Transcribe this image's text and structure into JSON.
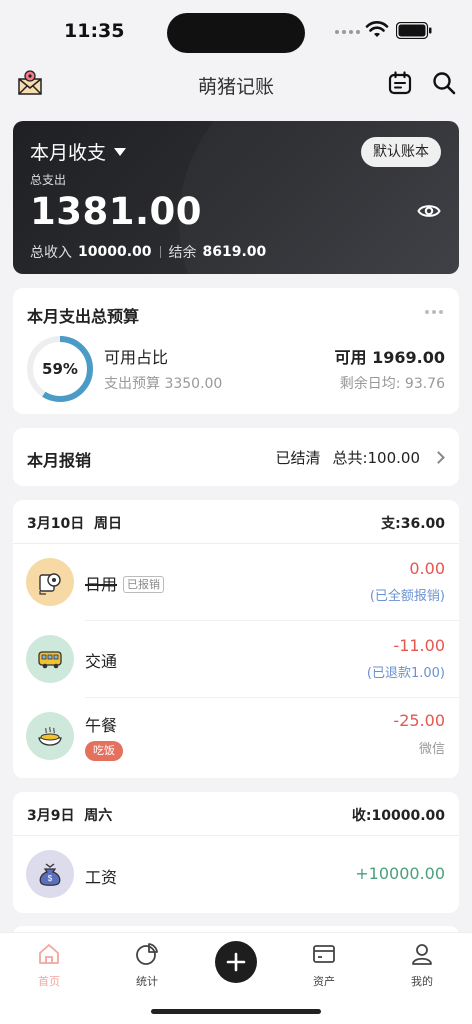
{
  "status": {
    "time": "11:35"
  },
  "nav": {
    "title": "萌猪记账"
  },
  "summary": {
    "period_label": "本月收支",
    "book_button": "默认账本",
    "expense_label": "总支出",
    "expense_amount": "1381.00",
    "income_label": "总收入",
    "income_amount": "10000.00",
    "balance_label": "结余",
    "balance_amount": "8619.00"
  },
  "budget": {
    "title": "本月支出总预算",
    "percent": "59%",
    "percent_value": 0.59,
    "available_ratio_label": "可用占比",
    "budget_text": "支出预算 3350.00",
    "available_text": "可用 1969.00",
    "daily_text": "剩余日均: 93.76"
  },
  "reimbursement": {
    "title": "本月报销",
    "status": "已结清",
    "total": "总共:100.00"
  },
  "days": [
    {
      "date": "3月10日",
      "weekday": "周日",
      "summary": "支:36.00",
      "items": [
        {
          "category": "日用",
          "tag": "已报销",
          "amount": "0.00",
          "note": "(已全额报销)",
          "icon": "toilet-paper-icon"
        },
        {
          "category": "交通",
          "amount": "-11.00",
          "note": "(已退款1.00)",
          "icon": "bus-icon"
        },
        {
          "category": "午餐",
          "tag": "吃饭",
          "amount": "-25.00",
          "note": "微信",
          "icon": "meal-icon"
        }
      ]
    },
    {
      "date": "3月9日",
      "weekday": "周六",
      "summary": "收:10000.00",
      "items": [
        {
          "category": "工资",
          "amount": "+10000.00",
          "icon": "money-bag-icon"
        }
      ]
    }
  ],
  "tabs": [
    {
      "label": "首页",
      "icon": "home-icon",
      "active": true
    },
    {
      "label": "统计",
      "icon": "pie-chart-icon"
    },
    {
      "label": "add",
      "icon": "plus-icon"
    },
    {
      "label": "资产",
      "icon": "card-icon"
    },
    {
      "label": "我的",
      "icon": "person-icon"
    }
  ],
  "colors": {
    "expense": "#e5574f",
    "income": "#4aa07e",
    "refund_note": "#6b92d0",
    "ring": "#4a9cc7",
    "active_tab": "#f3a6a0"
  }
}
